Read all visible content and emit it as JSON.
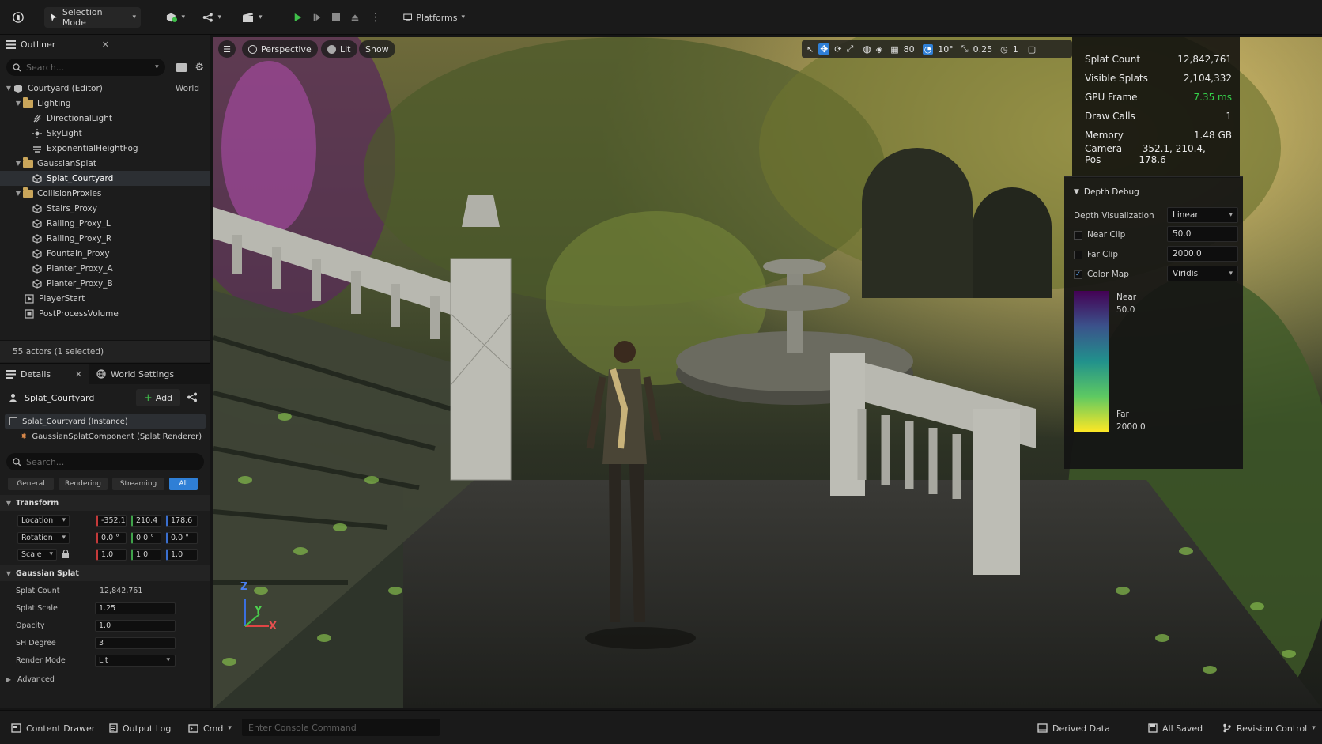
{
  "toolbar": {
    "mode_label": "Selection Mode",
    "platforms_label": "Platforms"
  },
  "outliner": {
    "tab_label": "Outliner",
    "search_placeholder": "Search...",
    "world_label": "World",
    "items": [
      {
        "label": "Courtyard (Editor)",
        "icon": "world-icon"
      },
      {
        "label": "Lighting",
        "icon": "folder-icon"
      },
      {
        "label": "DirectionalLight",
        "icon": "directional-light-icon"
      },
      {
        "label": "SkyLight",
        "icon": "skylight-icon"
      },
      {
        "label": "ExponentialHeightFog",
        "icon": "fog-icon"
      },
      {
        "label": "GaussianSplat",
        "icon": "folder-icon"
      },
      {
        "label": "Splat_Courtyard",
        "icon": "mesh-icon"
      },
      {
        "label": "CollisionProxies",
        "icon": "folder-icon"
      },
      {
        "label": "Stairs_Proxy",
        "icon": "mesh-icon"
      },
      {
        "label": "Railing_Proxy_L",
        "icon": "mesh-icon"
      },
      {
        "label": "Railing_Proxy_R",
        "icon": "mesh-icon"
      },
      {
        "label": "Fountain_Proxy",
        "icon": "mesh-icon"
      },
      {
        "label": "Planter_Proxy_A",
        "icon": "mesh-icon"
      },
      {
        "label": "Planter_Proxy_B",
        "icon": "mesh-icon"
      },
      {
        "label": "PlayerStart",
        "icon": "player-start-icon"
      },
      {
        "label": "PostProcessVolume",
        "icon": "volume-icon"
      }
    ],
    "footer": "55 actors (1 selected)"
  },
  "details": {
    "tab_label": "Details",
    "world_settings_label": "World Settings",
    "actor_name": "Splat_Courtyard",
    "add_label": "Add",
    "components": [
      "Splat_Courtyard (Instance)",
      "GaussianSplatComponent (Splat Renderer)"
    ],
    "search_placeholder": "Search...",
    "filters": [
      "General",
      "Rendering",
      "Streaming",
      "All"
    ],
    "transform": {
      "title": "Transform",
      "location_label": "Location",
      "rotation_label": "Rotation",
      "scale_label": "Scale",
      "location": [
        "-352.1",
        "210.4",
        "178.6"
      ],
      "rotation": [
        "0.0 °",
        "0.0 °",
        "0.0 °"
      ],
      "scale": [
        "1.0",
        "1.0",
        "1.0"
      ]
    },
    "gaussian": {
      "title": "Gaussian Splat",
      "rows": [
        {
          "label": "Splat Count",
          "value": "12,842,761"
        },
        {
          "label": "Splat Scale",
          "value": "1.25"
        },
        {
          "label": "Opacity",
          "value": "1.0"
        },
        {
          "label": "SH Degree",
          "value": "3"
        },
        {
          "label": "Render Mode",
          "value": "Lit"
        }
      ]
    },
    "advanced_label": "Advanced"
  },
  "viewport": {
    "perspective_label": "Perspective",
    "lit_label": "Lit",
    "show_label": "Show",
    "grid_value": "80",
    "angle_value": "10°",
    "scale_value": "0.25",
    "camera_speed": "1",
    "axis_labels": [
      "Z",
      "Y",
      "X"
    ]
  },
  "stats": [
    {
      "label": "Splat Count",
      "value": "12,842,761"
    },
    {
      "label": "Visible Splats",
      "value": "2,104,332"
    },
    {
      "label": "GPU Frame",
      "value": "7.35 ms"
    },
    {
      "label": "Draw Calls",
      "value": "1"
    },
    {
      "label": "Memory",
      "value": "1.48 GB"
    },
    {
      "label": "Camera Pos",
      "value": "-352.1, 210.4, 178.6"
    }
  ],
  "depth_debug": {
    "title": "Depth Debug",
    "viz_label": "Depth Visualization",
    "viz_value": "Linear",
    "near_clip_label": "Near Clip",
    "near_clip_value": "50.0",
    "far_clip_label": "Far Clip",
    "far_clip_value": "2000.0",
    "color_map_label": "Color Map",
    "color_map_value": "Viridis",
    "legend_near_label": "Near",
    "legend_near_value": "50.0",
    "legend_far_label": "Far",
    "legend_far_value": "2000.0"
  },
  "bottombar": {
    "content_drawer": "Content Drawer",
    "output_log": "Output Log",
    "cmd": "Cmd",
    "console_placeholder": "Enter Console Command",
    "derived_data": "Derived Data",
    "all_saved": "All Saved",
    "revision_control": "Revision Control"
  },
  "colors": {
    "accent": "#2f7fd6",
    "gpu_frame": "#35d04a",
    "play": "#3fbf4a"
  }
}
